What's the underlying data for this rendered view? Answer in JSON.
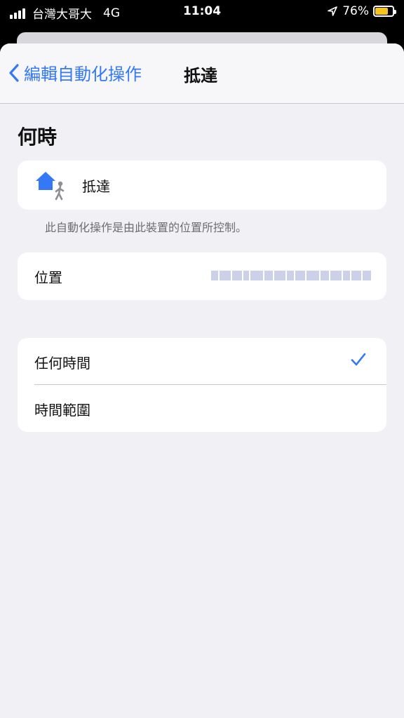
{
  "status_bar": {
    "carrier": "台灣大哥大",
    "network": "4G",
    "time": "11:04",
    "battery_pct": "76%",
    "battery_level": 0.76,
    "battery_color": "#f5c518",
    "location_icon": "location-arrow-icon"
  },
  "nav": {
    "back_label": "編輯自動化操作",
    "title": "抵達",
    "accent": "#3478f6"
  },
  "section": {
    "title": "何時"
  },
  "trigger": {
    "icon": "home-arrive-icon",
    "label": "抵達",
    "footnote": "此自動化操作是由此裝置的位置所控制。"
  },
  "location": {
    "label": "位置"
  },
  "time_options": [
    {
      "label": "任何時間",
      "selected": true
    },
    {
      "label": "時間範圍",
      "selected": false
    }
  ]
}
